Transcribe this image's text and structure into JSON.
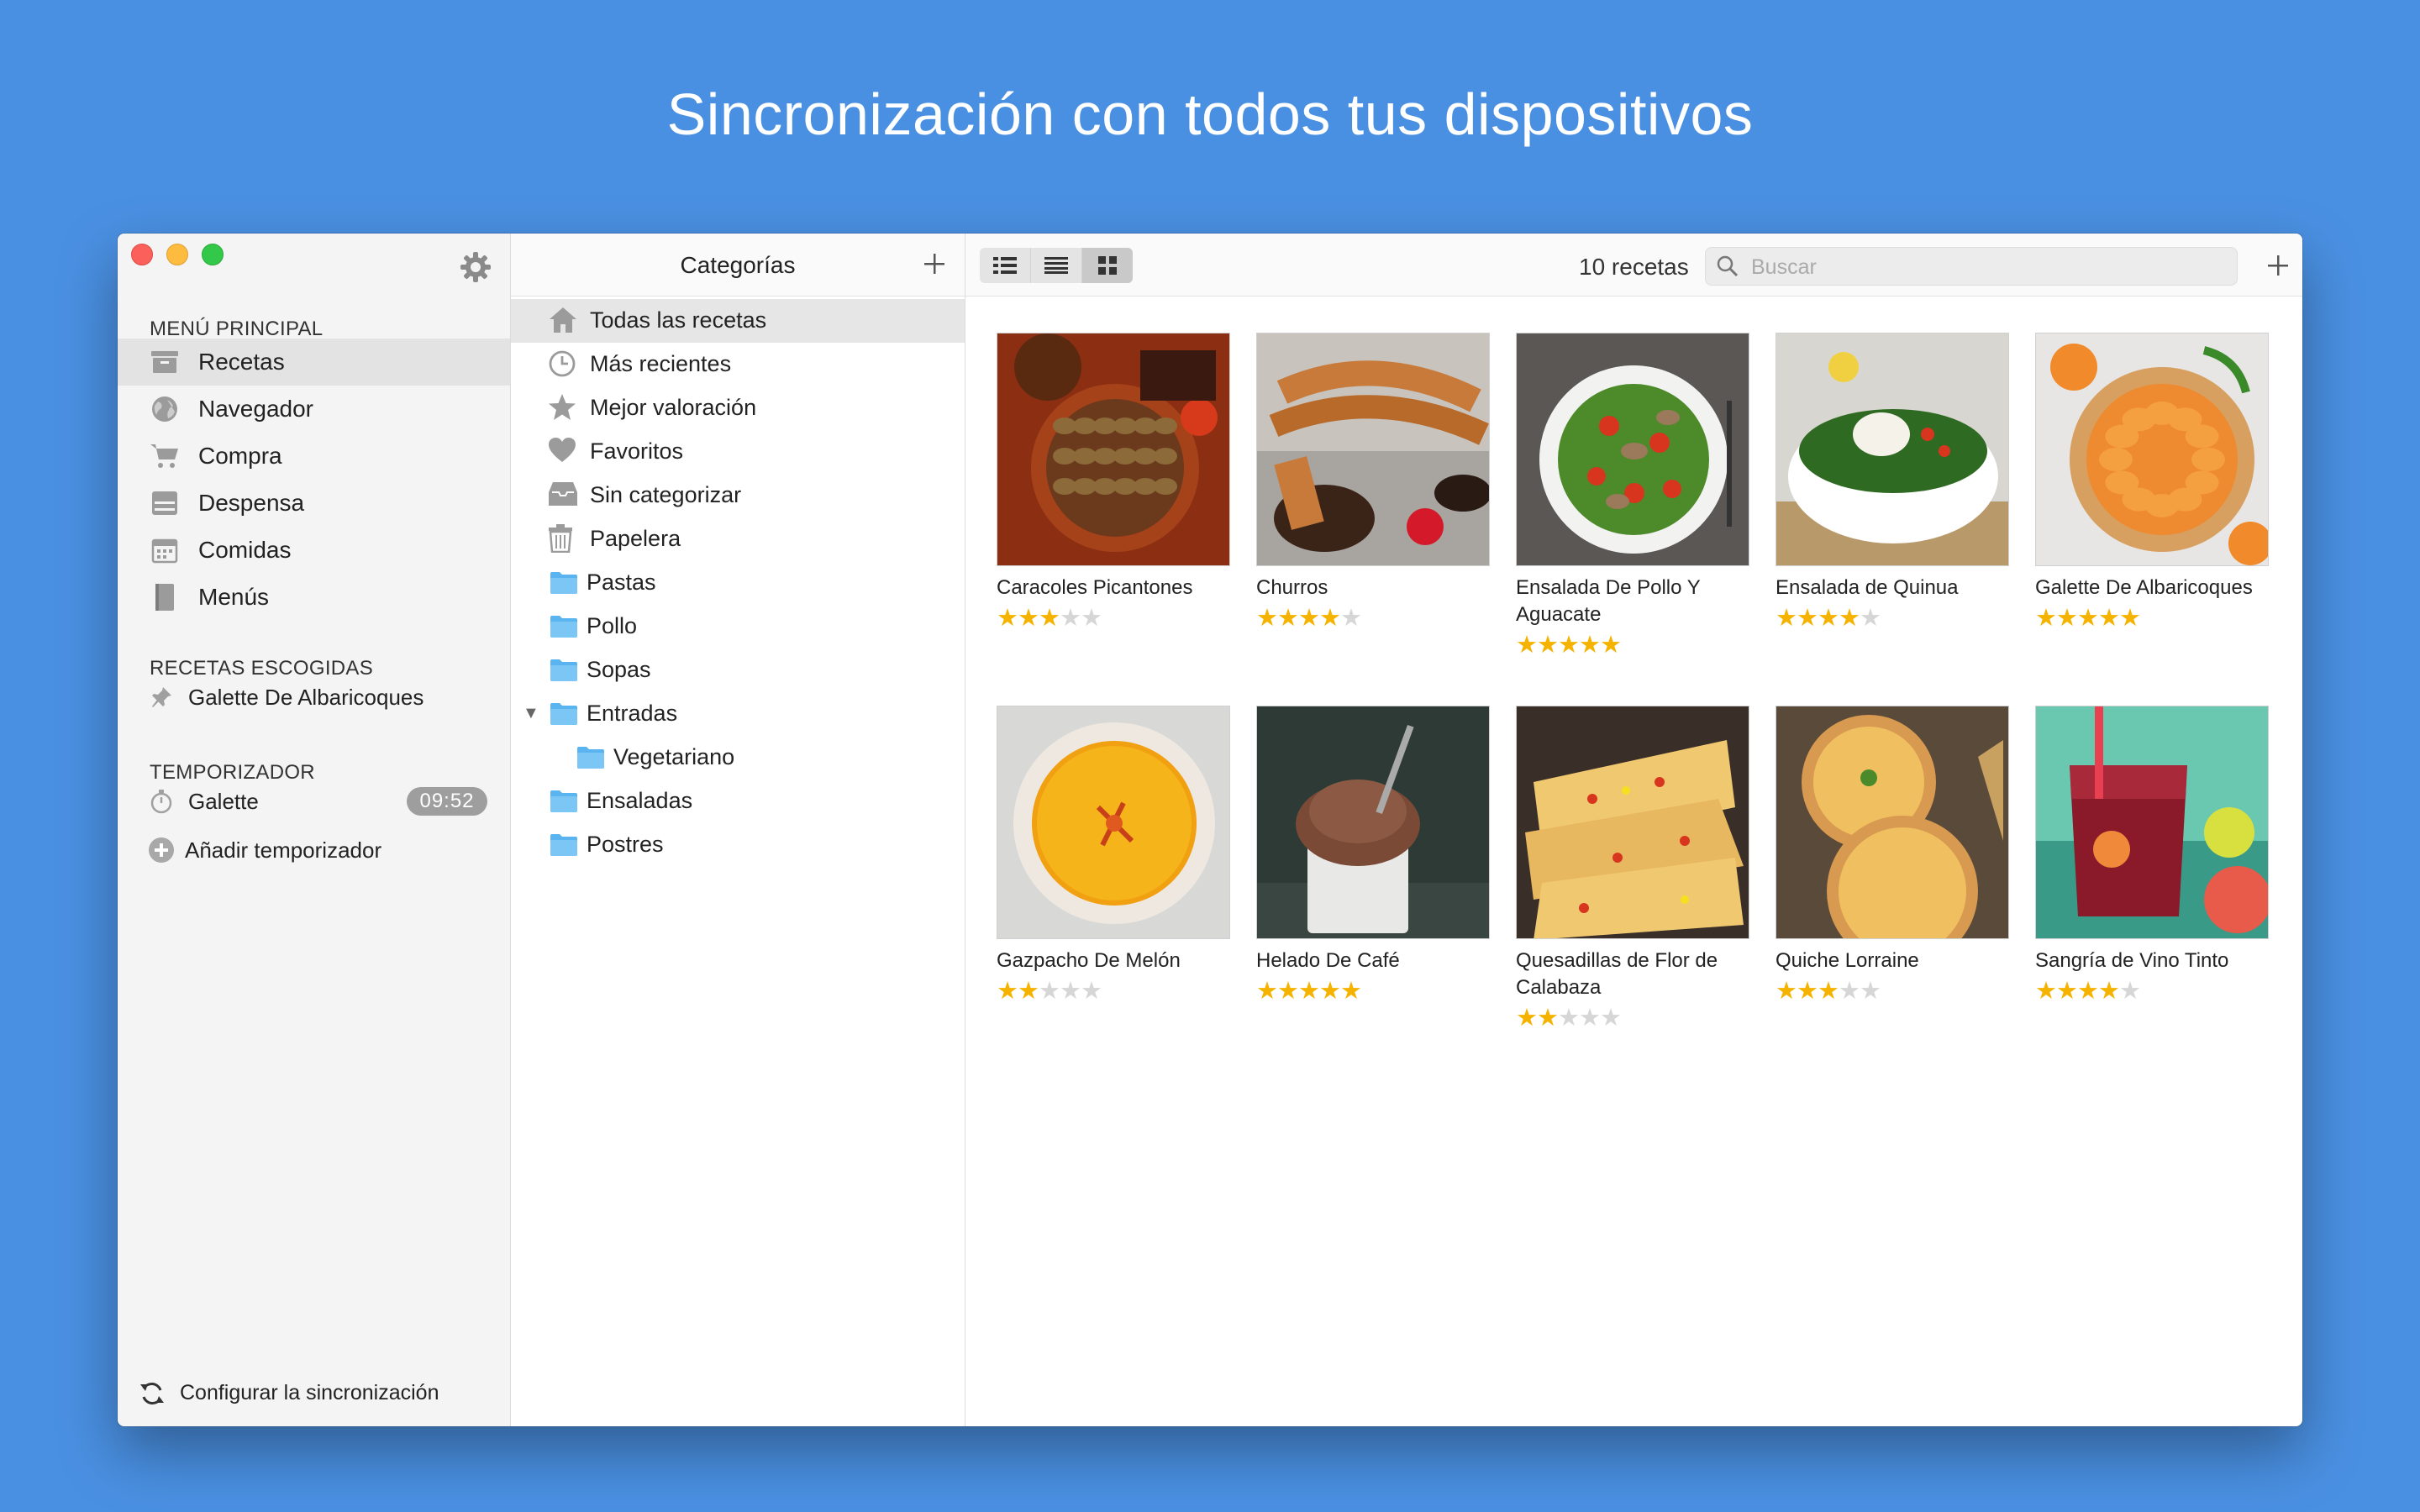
{
  "headline": "Sincronización con todos tus dispositivos",
  "colors": {
    "background": "#4a90e2",
    "star": "#f5b300",
    "folder": "#5ab4f0"
  },
  "sidebar": {
    "main_header": "MENÚ PRINCIPAL",
    "main_items": [
      {
        "label": "Recetas",
        "icon": "recipes-box-icon",
        "selected": true
      },
      {
        "label": "Navegador",
        "icon": "globe-icon"
      },
      {
        "label": "Compra",
        "icon": "cart-icon"
      },
      {
        "label": "Despensa",
        "icon": "pantry-icon"
      },
      {
        "label": "Comidas",
        "icon": "calendar-icon"
      },
      {
        "label": "Menús",
        "icon": "menu-book-icon"
      }
    ],
    "chosen_header": "RECETAS ESCOGIDAS",
    "chosen_item": {
      "label": "Galette De Albaricoques",
      "icon": "pin-icon"
    },
    "timer_header": "TEMPORIZADOR",
    "timer_item": {
      "label": "Galette",
      "time": "09:52",
      "icon": "stopwatch-icon"
    },
    "add_timer": "Añadir temporizador",
    "sync": "Configurar la sincronización"
  },
  "categories": {
    "title": "Categorías",
    "items": [
      {
        "label": "Todas las recetas",
        "icon": "home-icon",
        "selected": true
      },
      {
        "label": "Más recientes",
        "icon": "clock-icon"
      },
      {
        "label": "Mejor valoración",
        "icon": "star-icon"
      },
      {
        "label": "Favoritos",
        "icon": "heart-icon"
      },
      {
        "label": "Sin categorizar",
        "icon": "inbox-icon"
      },
      {
        "label": "Papelera",
        "icon": "trash-icon"
      },
      {
        "label": "Pastas",
        "icon": "folder-icon"
      },
      {
        "label": "Pollo",
        "icon": "folder-icon"
      },
      {
        "label": "Sopas",
        "icon": "folder-icon"
      },
      {
        "label": "Entradas",
        "icon": "folder-icon",
        "expanded": true
      },
      {
        "label": "Vegetariano",
        "icon": "folder-icon",
        "child": true
      },
      {
        "label": "Ensaladas",
        "icon": "folder-icon"
      },
      {
        "label": "Postres",
        "icon": "folder-icon"
      }
    ]
  },
  "toolbar": {
    "count": "10 recetas",
    "search_placeholder": "Buscar",
    "view_modes": [
      "detail-list-view-icon",
      "list-view-icon",
      "grid-view-icon"
    ],
    "active_view": 2
  },
  "recipes": [
    {
      "name": "Caracoles Picantones",
      "rating": 3
    },
    {
      "name": "Churros",
      "rating": 4
    },
    {
      "name": "Ensalada De Pollo Y Aguacate",
      "rating": 5
    },
    {
      "name": "Ensalada de Quinua",
      "rating": 4
    },
    {
      "name": "Galette De Albaricoques",
      "rating": 5
    },
    {
      "name": "Gazpacho De Melón",
      "rating": 2
    },
    {
      "name": "Helado De Café",
      "rating": 5
    },
    {
      "name": "Quesadillas de Flor de Calabaza",
      "rating": 2
    },
    {
      "name": "Quiche Lorraine",
      "rating": 3
    },
    {
      "name": "Sangría de Vino Tinto",
      "rating": 4
    }
  ]
}
